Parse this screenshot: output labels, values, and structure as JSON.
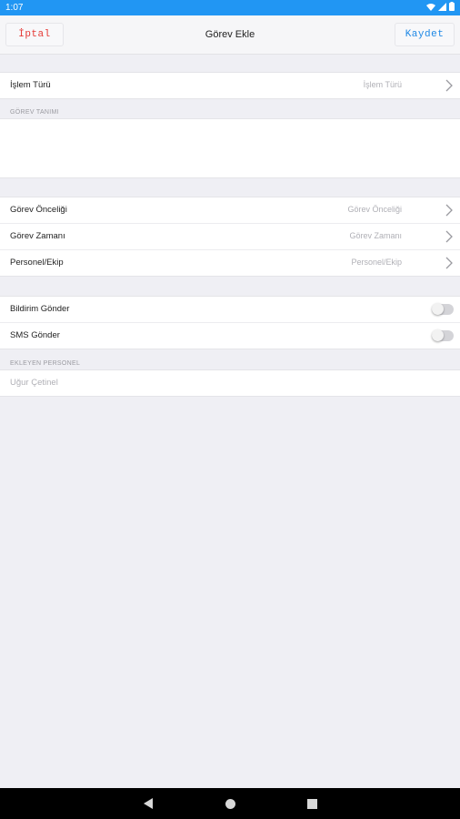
{
  "status_bar": {
    "time": "1:07",
    "icons": [
      "wifi-icon",
      "signal-icon",
      "battery-icon"
    ]
  },
  "header": {
    "title": "Görev Ekle",
    "cancel_label": "İptal",
    "save_label": "Kaydet"
  },
  "transaction_type": {
    "label": "İşlem Türü",
    "value": "İşlem Türü"
  },
  "task_definition": {
    "header": "GÖREV TANIMI",
    "value": ""
  },
  "details": [
    {
      "label": "Görev Önceliği",
      "value": "Görev Önceliği"
    },
    {
      "label": "Görev Zamanı",
      "value": "Görev Zamanı"
    },
    {
      "label": "Personel/Ekip",
      "value": "Personel/Ekip"
    }
  ],
  "notifications": {
    "send_notification": {
      "label": "Bildirim Gönder",
      "enabled": false
    },
    "send_sms": {
      "label": "SMS Gönder",
      "enabled": false
    }
  },
  "added_by": {
    "header": "EKLEYEN PERSONEL",
    "value": "Uğur Çetinel"
  },
  "colors": {
    "status_bar": "#2196f3",
    "cancel": "#e53935",
    "save": "#1e88e5",
    "background": "#efeff4"
  }
}
